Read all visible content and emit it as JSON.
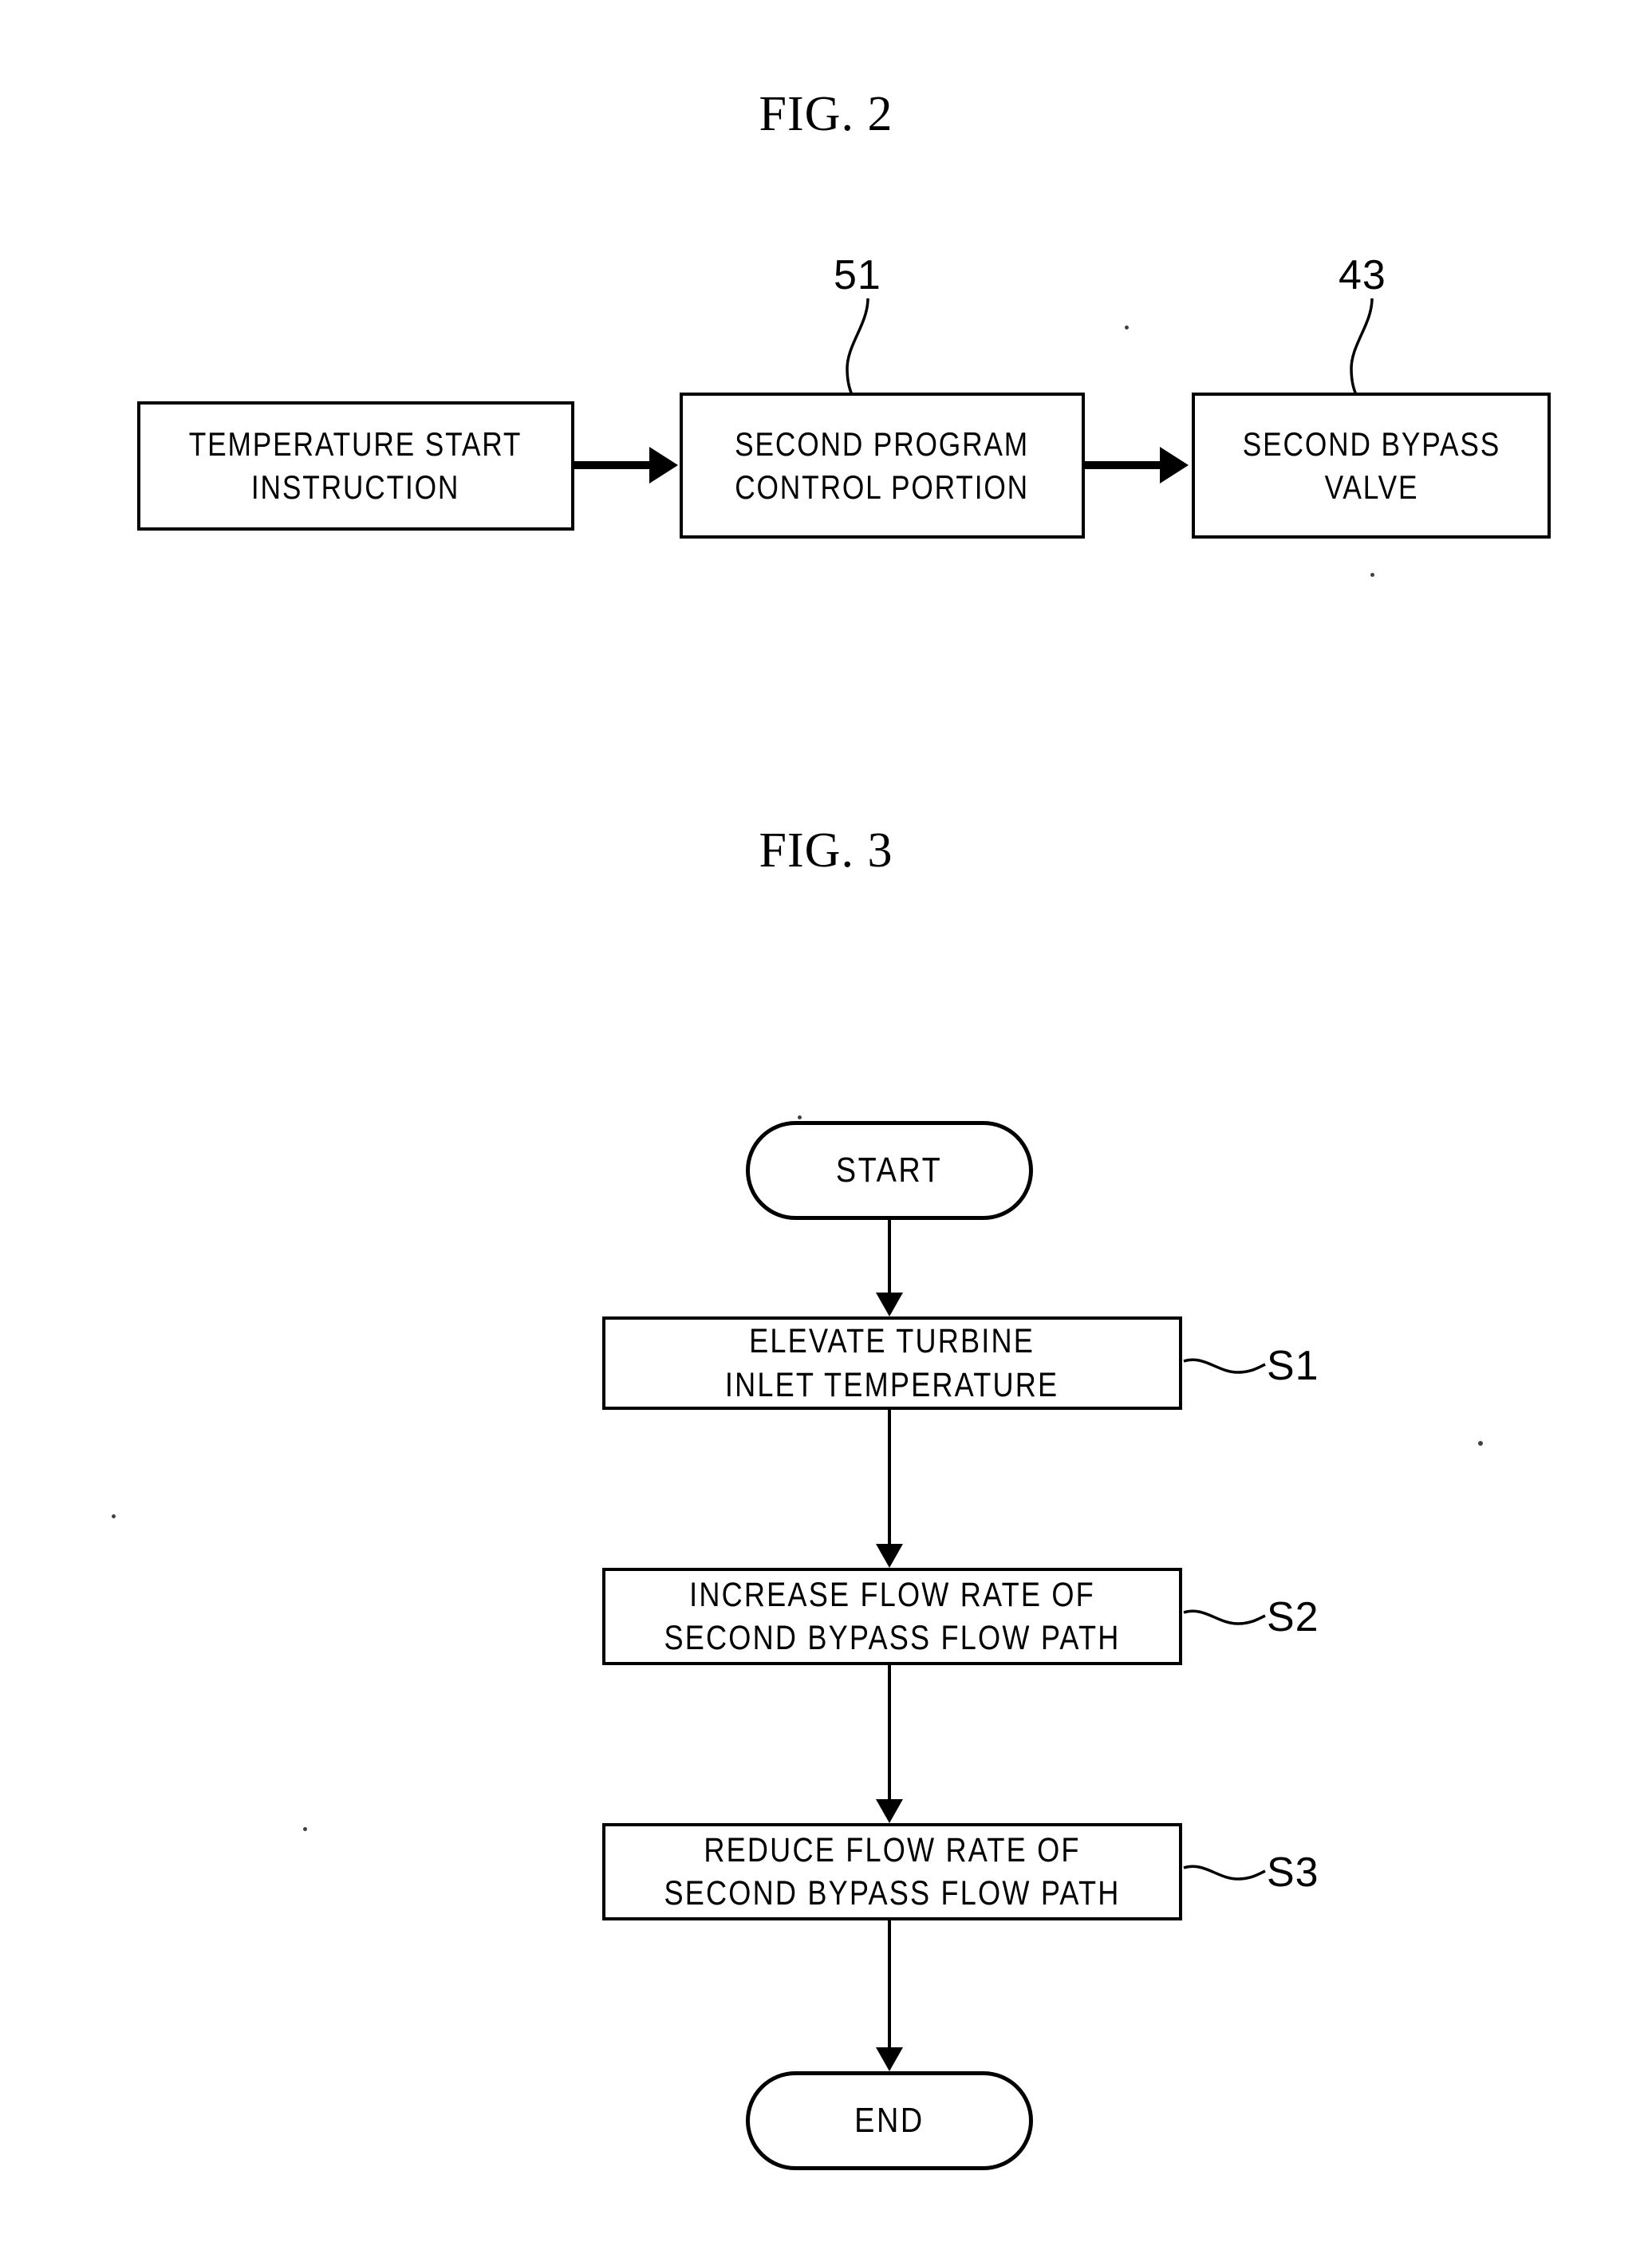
{
  "page": {
    "background_color": "#ffffff",
    "ink_color": "#000000"
  },
  "fig2": {
    "title": "FIG. 2",
    "type": "block-diagram",
    "blocks": [
      {
        "id": "temperature-start-instruction",
        "label": "TEMPERATURE START\nINSTRUCTION"
      },
      {
        "id": "second-program-control-portion",
        "label": "SECOND PROGRAM\nCONTROL PORTION"
      },
      {
        "id": "second-bypass-valve",
        "label": "SECOND BYPASS\nVALVE"
      }
    ],
    "reference_numerals": [
      {
        "id": "ref-51",
        "value": "51",
        "points_to": "second-program-control-portion"
      },
      {
        "id": "ref-43",
        "value": "43",
        "points_to": "second-bypass-valve"
      }
    ],
    "connections": [
      {
        "from": "temperature-start-instruction",
        "to": "second-program-control-portion",
        "style": "solid-arrow"
      },
      {
        "from": "second-program-control-portion",
        "to": "second-bypass-valve",
        "style": "solid-arrow"
      }
    ]
  },
  "fig3": {
    "title": "FIG. 3",
    "type": "flowchart",
    "start_label": "START",
    "end_label": "END",
    "steps": [
      {
        "step_id": "S1",
        "label": "ELEVATE TURBINE\nINLET TEMPERATURE"
      },
      {
        "step_id": "S2",
        "label": "INCREASE FLOW RATE OF\nSECOND BYPASS FLOW PATH"
      },
      {
        "step_id": "S3",
        "label": "REDUCE FLOW RATE OF\nSECOND BYPASS FLOW PATH"
      }
    ],
    "flow": [
      "START",
      "S1",
      "S2",
      "S3",
      "END"
    ]
  }
}
